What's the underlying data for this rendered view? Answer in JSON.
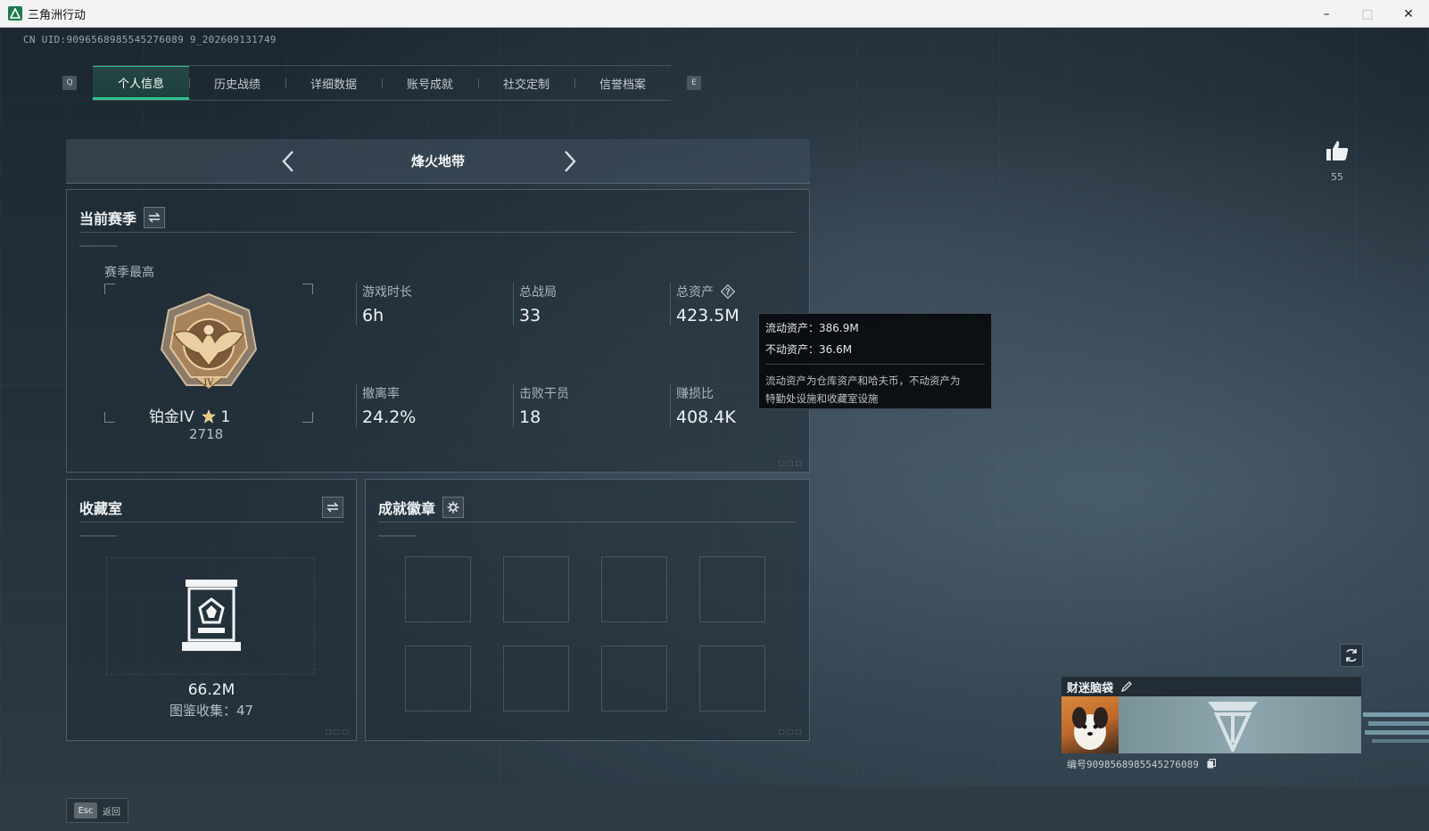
{
  "window": {
    "title": "三角洲行动"
  },
  "header": {
    "uid_line": "CN UID:9096568985545276089 9_202609131749",
    "watermark": ""
  },
  "tabs": {
    "left_key": "Q",
    "right_key": "E",
    "items": [
      {
        "label": "个人信息",
        "active": true
      },
      {
        "label": "历史战绩",
        "active": false
      },
      {
        "label": "详细数据",
        "active": false
      },
      {
        "label": "账号成就",
        "active": false
      },
      {
        "label": "社交定制",
        "active": false
      },
      {
        "label": "信誉档案",
        "active": false
      }
    ]
  },
  "mode": {
    "title": "烽火地带"
  },
  "season": {
    "title": "当前赛季",
    "best_label": "赛季最高",
    "rank_name": "铂金IV",
    "rank_stars": "1",
    "rank_score": "2718",
    "stats": [
      {
        "label": "游戏时长",
        "value": "6h"
      },
      {
        "label": "总战局",
        "value": "33"
      },
      {
        "label": "总资产",
        "value": "423.5M",
        "has_help": true
      },
      {
        "label": "撤离率",
        "value": "24.2%"
      },
      {
        "label": "击败干员",
        "value": "18"
      },
      {
        "label": "赚损比",
        "value": "408.4K"
      }
    ]
  },
  "tooltip": {
    "liquid": "流动资产：386.9M",
    "fixed": "不动资产：36.6M",
    "desc_line1": "流动资产为仓库资产和哈夫币，不动资产为",
    "desc_line2": "特勤处设施和收藏室设施"
  },
  "collection": {
    "title": "收藏室",
    "value": "66.2M",
    "count": "图鉴收集：47"
  },
  "achievements": {
    "title": "成就徽章",
    "slots": 8
  },
  "likes": {
    "count": "55"
  },
  "namecard": {
    "name": "财迷脑袋",
    "id_line": "编号9098568985545276089"
  },
  "footer": {
    "esc_key": "Esc",
    "esc_label": "返回"
  },
  "colors": {
    "accent": "#2fc38a",
    "panel_border": "#bfcdd7",
    "tooltip_bg": "#080c0f"
  }
}
